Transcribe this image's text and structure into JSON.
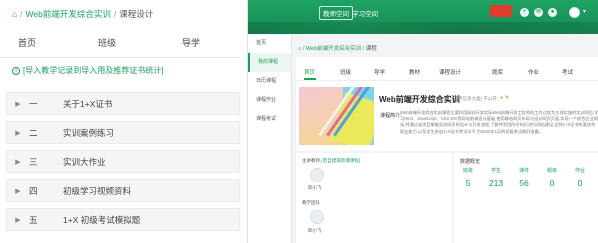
{
  "left": {
    "breadcrumb": {
      "home_icon": "home-icon",
      "course": "Web前端开发综合实训",
      "separator": "/",
      "current": "课程设计"
    },
    "tabs": [
      "首页",
      "班级",
      "导学"
    ],
    "tip": "[导入教学记录到导入用及推荐证书统计]",
    "chapters": [
      {
        "num": "一",
        "title": "关于1+X证书"
      },
      {
        "num": "二",
        "title": "实训案例练习"
      },
      {
        "num": "三",
        "title": "实训大作业"
      },
      {
        "num": "四",
        "title": "初级学习视频资料"
      },
      {
        "num": "五",
        "title": "1+X 初级考试模拟题"
      }
    ]
  },
  "right": {
    "header": {
      "nav": [
        "教师空间",
        "学习空间"
      ],
      "active_nav": "教师空间",
      "accent": "#1fa464"
    },
    "sidebar": [
      "首页",
      "我的课程",
      "日历课程",
      "课程作业",
      "课程考试"
    ],
    "sidebar_active": 1,
    "breadcrumb": {
      "course": "Web前端开发综合实训",
      "current": "课程"
    },
    "course_tabs": [
      "首页",
      "班级",
      "导学",
      "教材",
      "课程设计",
      "题库",
      "作业",
      "考试"
    ],
    "course_tab_active": 0,
    "course": {
      "title": "Web前端开发综合实训",
      "meta": "(电子信息大类)  不公开",
      "intro_label": "课程简介:",
      "intro": "Web前端开发综合实训课程主要利用网站开发实际Web前端开发工程师的工作过程为主线实施的实训项目,学习Html、JavaScript、CSS DIV等网站前端设计基础,使用静态网页布局与设计网页页面,实现一个综合企业网站,并通过该项目掌握实训网页的设计与开发流程,了解并利用所学知识进行网站建设,达到1+X证书所要求的职业能力,以及学生参加1+X证书考试水平,为2020年1月的初级考试做好准备。"
    },
    "teachers": {
      "label_main": "主讲教师",
      "link": "(若自建或新增课程)",
      "main_name": "邱小飞",
      "label_assist": "教学团队",
      "assist_name": "邱小飞"
    },
    "stats": {
      "heading": "数据概览",
      "items": [
        {
          "key": "班级",
          "value": "5"
        },
        {
          "key": "学生",
          "value": "213"
        },
        {
          "key": "课件",
          "value": "56"
        },
        {
          "key": "题目",
          "value": "0"
        },
        {
          "key": "作业",
          "value": "0"
        }
      ]
    }
  }
}
